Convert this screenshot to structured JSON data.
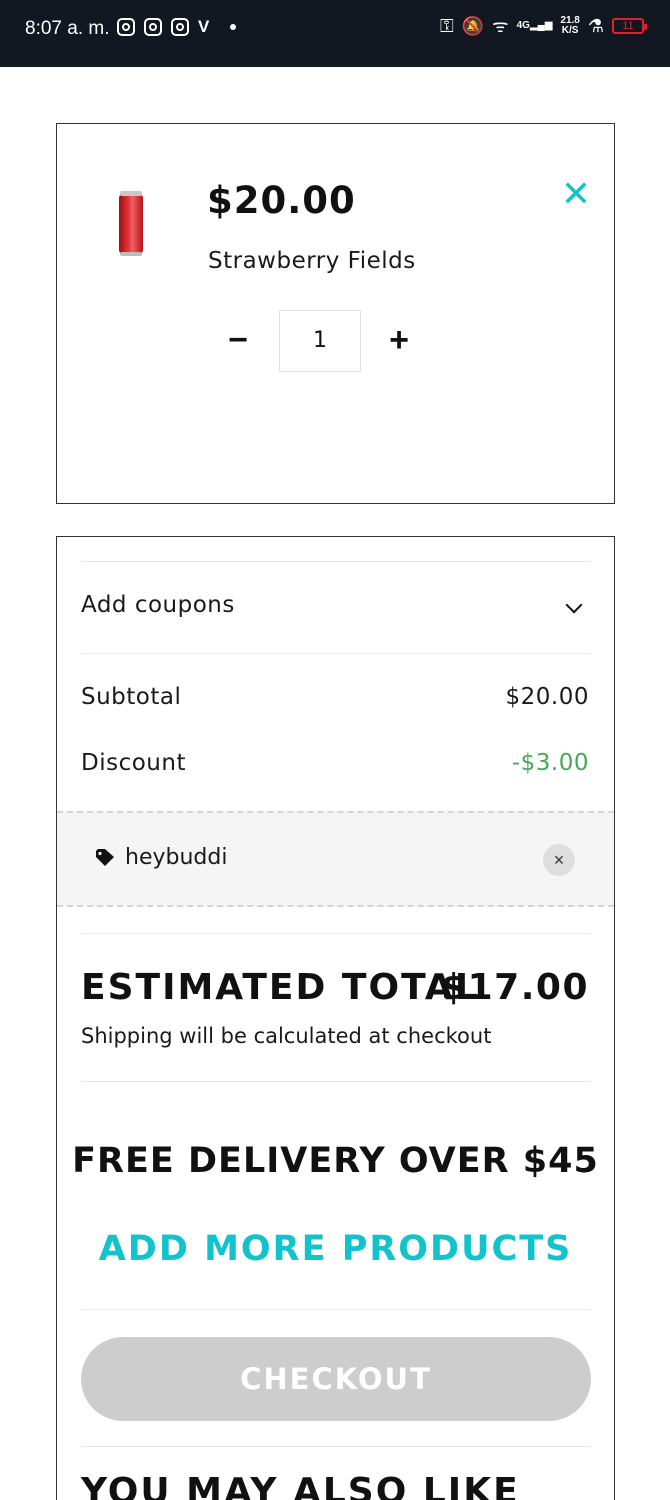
{
  "status_bar": {
    "time": "8:07 a. m.",
    "left_icons": [
      "instagram-icon",
      "instagram-icon",
      "instagram-icon",
      "shield-v-icon"
    ],
    "network_type": "4G",
    "data_rate": "21.8",
    "data_unit": "K/S",
    "battery_level": "11",
    "battery_color": "#e0202a"
  },
  "cart_item": {
    "price": "$20.00",
    "name": "Strawberry Fields",
    "quantity": "1",
    "minus_label": "−",
    "plus_label": "+",
    "remove_label": "✕",
    "image": "red-can-product-image"
  },
  "summary": {
    "coupons_label": "Add coupons",
    "subtotal_label": "Subtotal",
    "subtotal_value": "$20.00",
    "discount_label": "Discount",
    "discount_value": "-$3.00",
    "applied_coupon": "heybuddi",
    "coupon_remove_label": "×",
    "estimated_total_label": "ESTIMATED TOTAL",
    "estimated_total_value": "$17.00",
    "shipping_note": "Shipping will be calculated at checkout",
    "free_delivery_text": "FREE DELIVERY OVER $45",
    "add_more_label": "ADD MORE PRODUCTS",
    "checkout_label": "CHECKOUT",
    "also_like_heading": "YOU MAY ALSO LIKE"
  },
  "colors": {
    "accent": "#10c3cc",
    "discount": "#45a85a",
    "checkout_disabled": "#cdcdcd"
  }
}
